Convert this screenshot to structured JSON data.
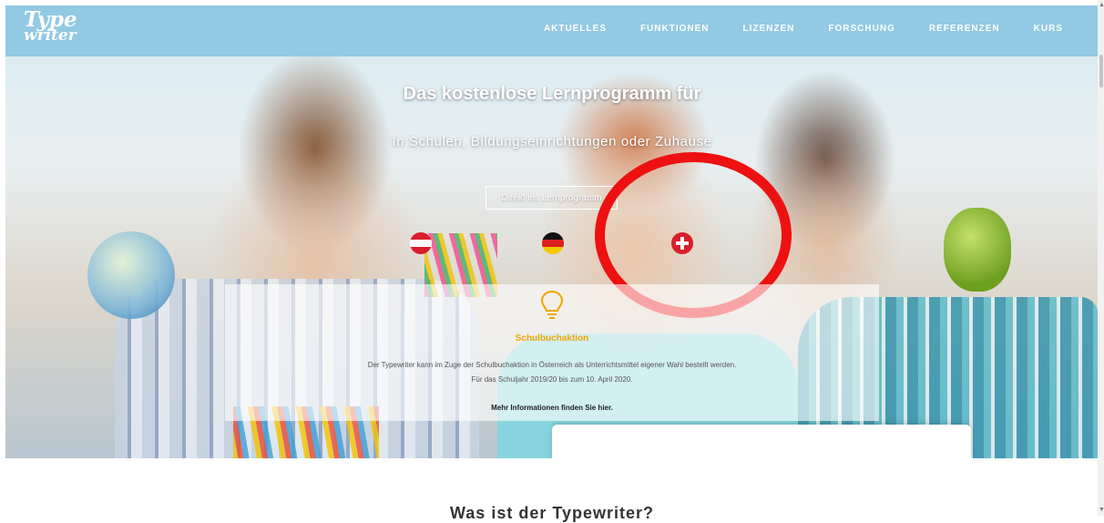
{
  "logo": {
    "line1": "Type",
    "line2": "writer"
  },
  "nav": {
    "items": [
      "AKTUELLES",
      "FUNKTIONEN",
      "LIZENZEN",
      "FORSCHUNG",
      "REFERENZEN",
      "KURS"
    ]
  },
  "hero": {
    "title": "Das kostenlose Lernprogramm für",
    "subtitle": "In Schulen, Bildungseinrichtungen oder Zuhause",
    "cta_label": "Direkt ins Lernprogramm"
  },
  "flags": [
    "austria-flag-icon",
    "germany-flag-icon",
    "switzerland-flag-icon"
  ],
  "annotation": {
    "color": "#ee1111"
  },
  "info": {
    "icon": "lightbulb-icon",
    "title": "Schulbuchaktion",
    "text1": "Der Typewriter kann im Zuge der Schulbuchaktion in Österreich als Unterrichtsmittel eigener Wahl bestellt werden.",
    "text2": "Für das Schuljahr 2019/20 bis zum 10. April 2020.",
    "link": "Mehr Informationen finden Sie hier."
  },
  "section": {
    "heading": "Was ist der Typewriter?"
  },
  "colors": {
    "navbar": "#88c4e0",
    "accent": "#f0a500"
  }
}
